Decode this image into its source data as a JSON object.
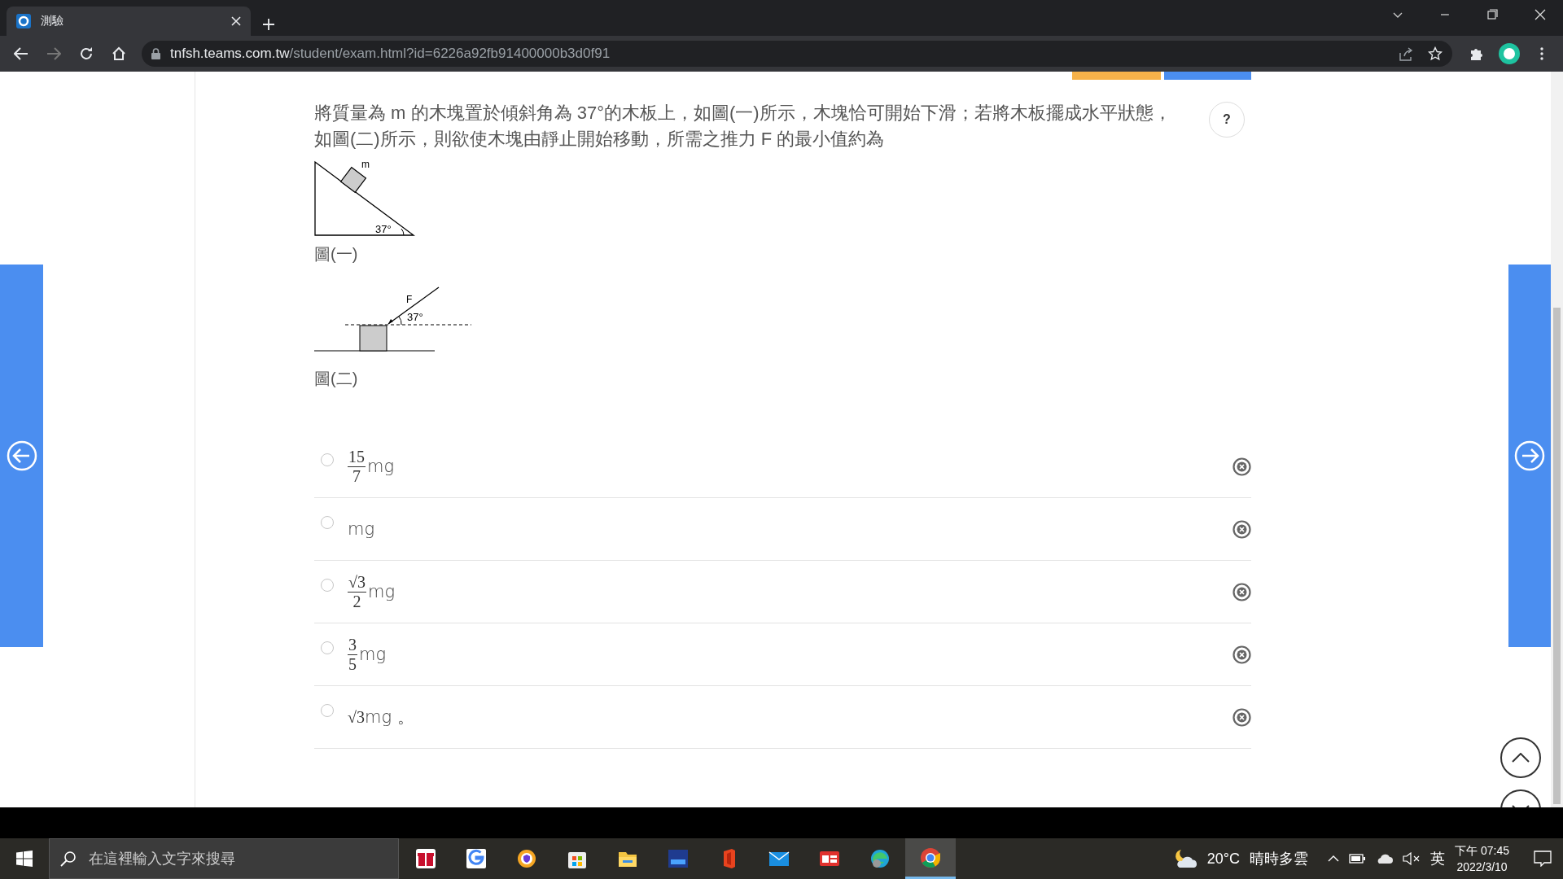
{
  "browser": {
    "tab_title": "測驗",
    "url_host": "tnfsh.teams.com.tw",
    "url_path": "/student/exam.html?id=6226a92fb91400000b3d0f91"
  },
  "question": {
    "text": "將質量為 m 的木塊置於傾斜角為 37°的木板上，如圖(一)所示，木塊恰可開始下滑；若將木板擺成水平狀態，如圖(二)所示，則欲使木塊由靜止開始移動，所需之推力 F 的最小值約為",
    "help_button": "?",
    "figures": [
      {
        "kind": "incline",
        "labels": [
          "m",
          "37°"
        ],
        "caption": "圖(一)"
      },
      {
        "kind": "push",
        "labels": [
          "F",
          "37°"
        ],
        "caption": "圖(二)"
      }
    ],
    "options": [
      {
        "kind": "fraction",
        "numerator": "15",
        "denominator": "7",
        "text": "mg",
        "selected": false
      },
      {
        "kind": "plain",
        "text": "mg",
        "selected": false
      },
      {
        "kind": "fraction",
        "numerator": "√3",
        "denominator": "2",
        "text": "mg",
        "selected": false
      },
      {
        "kind": "fraction",
        "numerator": "3",
        "denominator": "5",
        "text": "mg",
        "selected": false
      },
      {
        "kind": "radical",
        "radicand": "√3",
        "text": "mg 。",
        "selected": false
      }
    ]
  },
  "taskbar": {
    "search_placeholder": "在這裡輸入文字來搜尋",
    "apps": [
      {
        "kind": "gift",
        "active": false
      },
      {
        "kind": "google",
        "active": false
      },
      {
        "kind": "shield",
        "active": false
      },
      {
        "kind": "store",
        "active": false
      },
      {
        "kind": "folder",
        "active": false
      },
      {
        "kind": "dev",
        "active": false
      },
      {
        "kind": "office",
        "active": false
      },
      {
        "kind": "mail",
        "active": false
      },
      {
        "kind": "news",
        "active": false
      },
      {
        "kind": "edge",
        "active": false
      },
      {
        "kind": "chrome",
        "active": true
      }
    ],
    "temperature": "20°C",
    "weather": "晴時多雲",
    "ime": "英",
    "time": "下午 07:45",
    "date": "2022/3/10"
  }
}
